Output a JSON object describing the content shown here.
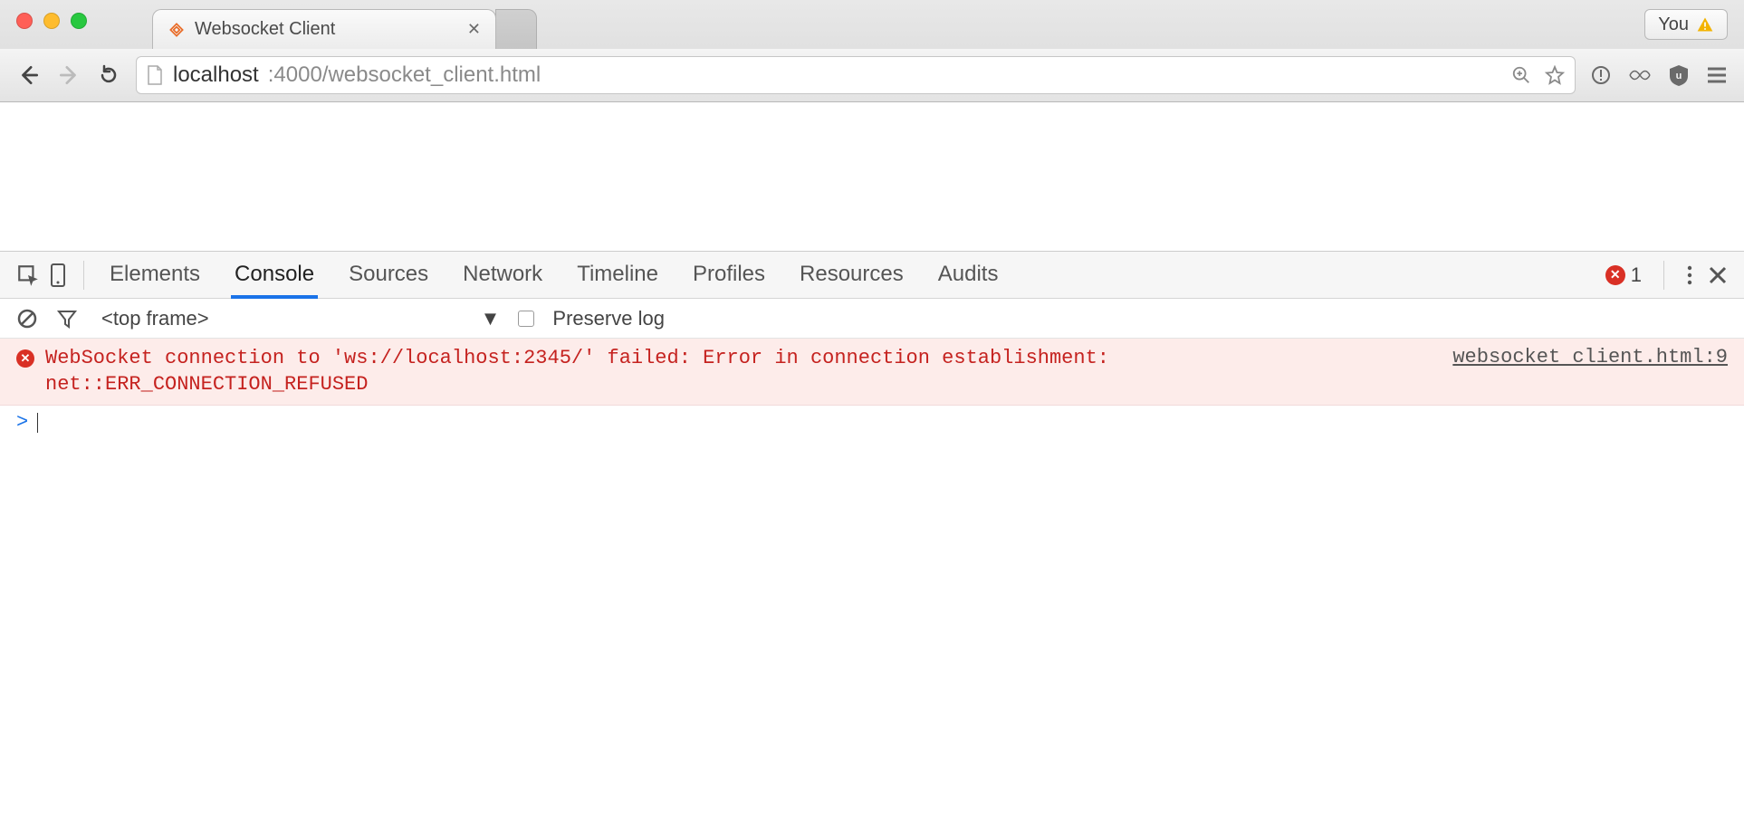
{
  "browser": {
    "tab_title": "Websocket Client",
    "profile_label": "You",
    "url_host": "localhost",
    "url_port_path": ":4000/websocket_client.html"
  },
  "devtools": {
    "tabs": [
      "Elements",
      "Console",
      "Sources",
      "Network",
      "Timeline",
      "Profiles",
      "Resources",
      "Audits"
    ],
    "active_tab": "Console",
    "error_count": "1",
    "frame_label": "<top frame>",
    "preserve_log_label": "Preserve log"
  },
  "console": {
    "error_text": "WebSocket connection to 'ws://localhost:2345/' failed: Error in connection establishment: net::ERR_CONNECTION_REFUSED",
    "error_source": "websocket client.html:9",
    "prompt": ">"
  }
}
